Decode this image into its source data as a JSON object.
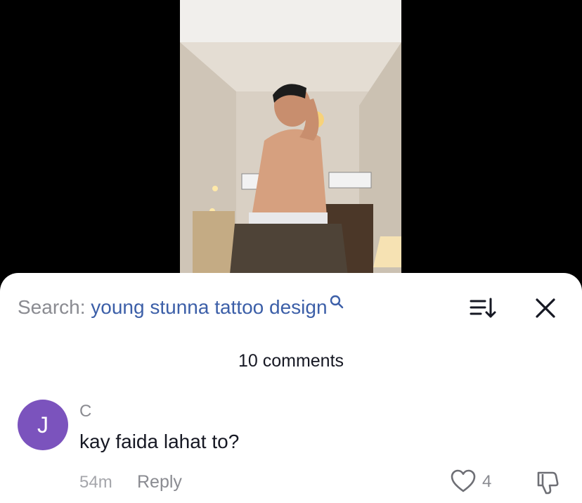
{
  "search": {
    "prefix": "Search:",
    "query": "young stunna tattoo design"
  },
  "comments_header": {
    "count_label": "10 comments"
  },
  "comments": [
    {
      "avatar_initial": "J",
      "avatar_color": "#7b53bd",
      "username": "C",
      "text": "kay faida lahat to?",
      "time": "54m",
      "reply_label": "Reply",
      "likes": "4"
    }
  ],
  "icons": {
    "search": "magnifier-icon",
    "sort": "sort-icon",
    "close": "close-icon",
    "like": "heart-outline-icon",
    "dislike": "thumbs-down-icon"
  },
  "colors": {
    "search_link": "#3c5fa8",
    "text_primary": "#161823",
    "text_secondary": "#8a8b91",
    "avatar": "#7b53bd"
  }
}
